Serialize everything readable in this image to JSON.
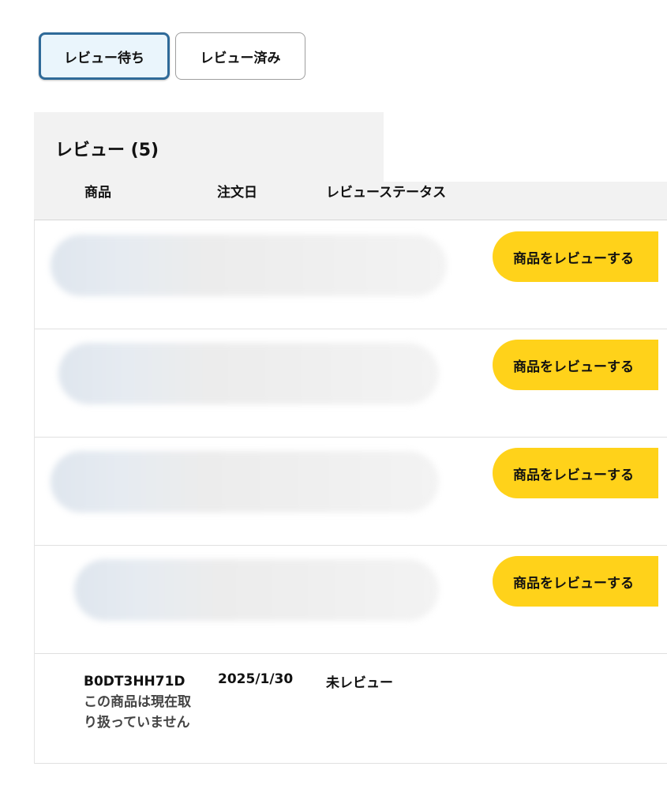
{
  "tabs": [
    {
      "label": "レビュー待ち",
      "active": true
    },
    {
      "label": "レビュー済み",
      "active": false
    }
  ],
  "review_section": {
    "title": "レビュー (5)"
  },
  "columns": [
    "商品",
    "注文日",
    "レビューステータス"
  ],
  "rows": [
    {
      "product": "",
      "action_label": "商品をレビューする"
    },
    {
      "product": "",
      "action_label": "商品をレビューする"
    },
    {
      "product": "",
      "action_label": "商品をレビューする"
    },
    {
      "product": "",
      "action_label": "商品をレビューする"
    }
  ],
  "last_row": {
    "product_id": "B0DT3HH71D",
    "product_note": "この商品は現在取り扱っていません",
    "order_date": "2025/1/30",
    "status": "未レビュー"
  },
  "colors": {
    "accent_button": "#ffd21a",
    "active_tab_border": "#2f6a99",
    "active_tab_bg": "#eaf5fc",
    "header_bg": "#f2f2f2"
  }
}
